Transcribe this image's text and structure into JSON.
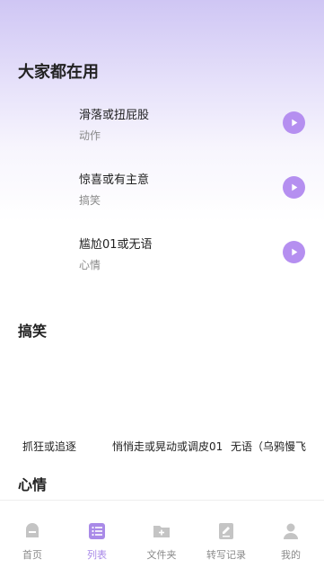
{
  "sections": {
    "popular": {
      "title": "大家都在用",
      "items": [
        {
          "title": "滑落或扭屁股",
          "category": "动作"
        },
        {
          "title": "惊喜或有主意",
          "category": "搞笑"
        },
        {
          "title": "尴尬01或无语",
          "category": "心情"
        }
      ]
    },
    "funny": {
      "title": "搞笑",
      "items": [
        "抓狂或追逐",
        "悄悄走或晃动或调皮01",
        "无语（乌鸦慢飞"
      ]
    },
    "mood": {
      "title": "心情"
    }
  },
  "tabbar": {
    "active": "list",
    "tabs": [
      {
        "label": "首页",
        "icon": "home-icon"
      },
      {
        "label": "列表",
        "icon": "list-icon"
      },
      {
        "label": "文件夹",
        "icon": "folder-icon"
      },
      {
        "label": "转写记录",
        "icon": "edit-note-icon"
      },
      {
        "label": "我的",
        "icon": "user-icon"
      }
    ]
  },
  "colors": {
    "accent": "#b58ff0",
    "tab_active": "#a98ae8",
    "tab_inactive": "#c4c4c4",
    "header_gradient_top": "#cfc6f4"
  }
}
